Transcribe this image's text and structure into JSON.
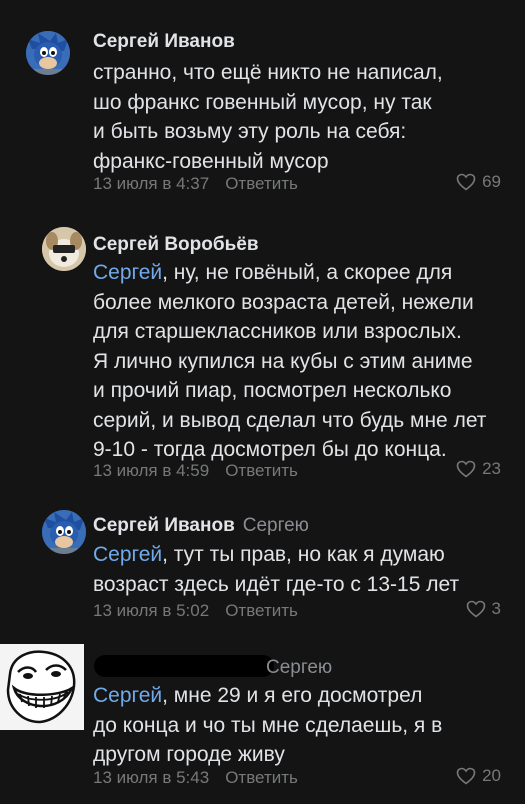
{
  "comments": [
    {
      "author": "Сергей Иванов",
      "reply_to": "",
      "mention": "",
      "lines": [
        "странно, что ещё никто не написал,",
        "шо франкс говенный мусор, ну так",
        "и быть возьму эту роль на себя:",
        "франкс-говенный мусор"
      ],
      "date": "13 июля в 4:37",
      "reply_label": "Ответить",
      "likes": "69",
      "avatar": "sonic-avatar"
    },
    {
      "author": "Сергей Воробьёв",
      "reply_to": "",
      "mention": "Сергей",
      "lines": [
        ", ну, не говёный, а скорее для",
        "более мелкого возраста детей, нежели",
        "для старшеклассников или взрослых.",
        "Я лично купился на кубы с этим аниме",
        "и прочий пиар, посмотрел несколько",
        "серий, и вывод сделал что будь мне лет",
        "9-10 - тогда досмотрел бы до конца."
      ],
      "date": "13 июля в 4:59",
      "reply_label": "Ответить",
      "likes": "23",
      "avatar": "dog-avatar"
    },
    {
      "author": "Сергей Иванов",
      "reply_to": "Сергею",
      "mention": "Сергей",
      "lines": [
        ", тут ты прав, но как я думаю",
        "возраст здесь идёт где-то с 13-15 лет"
      ],
      "date": "13 июля в 5:02",
      "reply_label": "Ответить",
      "likes": "3",
      "avatar": "sonic-avatar"
    },
    {
      "author": "",
      "reply_to": "Сергею",
      "mention": "Сергей",
      "lines": [
        ", мне 29 и я его досмотрел",
        "до конца и чо ты мне сделаешь, я в",
        "другом городе живу"
      ],
      "date": "13 июля в 5:43",
      "reply_label": "Ответить",
      "likes": "20",
      "avatar": "trollface-avatar"
    }
  ],
  "colors": {
    "background": "#141414",
    "text": "#e1e3e6",
    "secondary": "#76787a",
    "link": "#71aaeb"
  }
}
